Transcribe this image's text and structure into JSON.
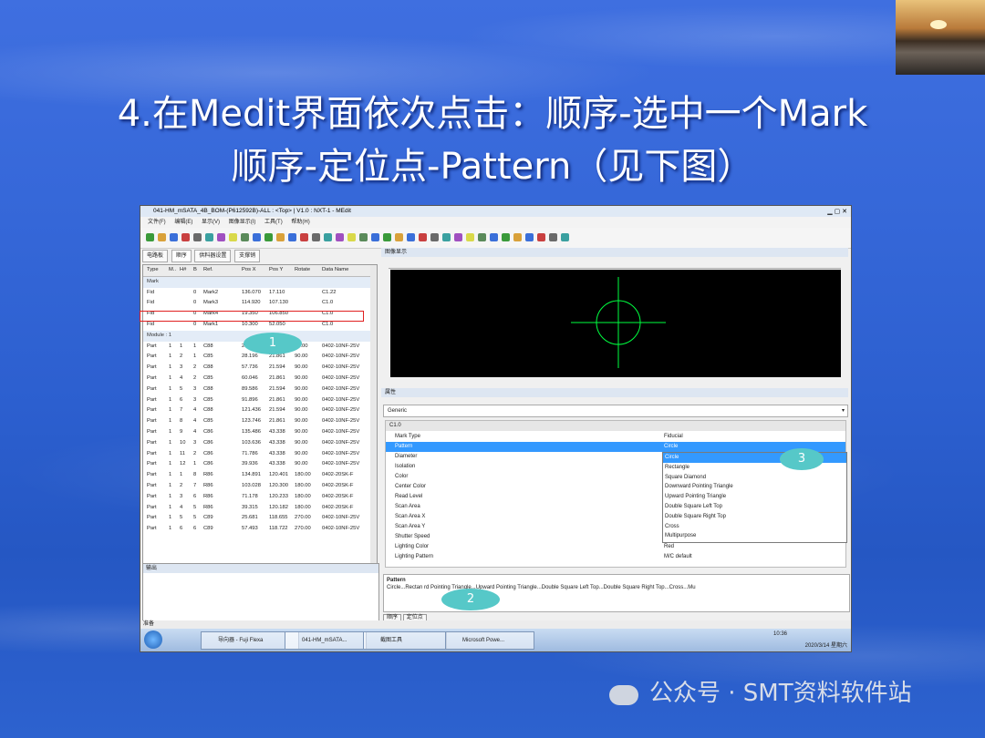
{
  "slide": {
    "title_line1": "4.在Medit界面依次点击：顺序-选中一个Mark",
    "title_line2": "顺序-定位点-Pattern（见下图）",
    "watermark": "公众号 · SMT资料软件站"
  },
  "window": {
    "title": "041-HM_mSATA_4B_BOM-(P612592B)-ALL : <Top> | V1.0 : NXT-1 - MEdit",
    "menu": [
      "文件(F)",
      "编辑(E)",
      "显示(V)",
      "图像显示(I)",
      "工具(T)",
      "帮助(H)"
    ],
    "tabs": [
      "电路板",
      "顺序",
      "供料器设置",
      "支撑销"
    ],
    "grid_headers": [
      "Type",
      "M..",
      "H#",
      "B",
      "Ref.",
      "Pos X",
      "Pos Y",
      "Rotate",
      "Data Name"
    ],
    "mark_group": "Mark",
    "mark_rows": [
      [
        "Fid",
        "",
        "",
        "0",
        "Mark2",
        "136.070",
        "17.110",
        "",
        "C1.22"
      ],
      [
        "Fid",
        "",
        "",
        "0",
        "Mark3",
        "114.920",
        "107.130",
        "",
        "C1.0"
      ],
      [
        "Fid",
        "",
        "",
        "0",
        "Mark4",
        "19.350",
        "106.850",
        "",
        "C1.0"
      ],
      [
        "Fid",
        "",
        "",
        "0",
        "Mark1",
        "10.300",
        "52.050",
        "",
        "C1.0"
      ]
    ],
    "module_group": "Module : 1",
    "part_rows": [
      [
        "Part",
        "1",
        "1",
        "1",
        "C88",
        "25.800",
        "21.594",
        "90.00",
        "0402-10NF-25V"
      ],
      [
        "Part",
        "1",
        "2",
        "1",
        "C85",
        "28.196",
        "21.861",
        "90.00",
        "0402-10NF-25V"
      ],
      [
        "Part",
        "1",
        "3",
        "2",
        "C88",
        "57.736",
        "21.594",
        "90.00",
        "0402-10NF-25V"
      ],
      [
        "Part",
        "1",
        "4",
        "2",
        "C85",
        "60.046",
        "21.861",
        "90.00",
        "0402-10NF-25V"
      ],
      [
        "Part",
        "1",
        "5",
        "3",
        "C88",
        "89.586",
        "21.594",
        "90.00",
        "0402-10NF-25V"
      ],
      [
        "Part",
        "1",
        "6",
        "3",
        "C85",
        "91.896",
        "21.861",
        "90.00",
        "0402-10NF-25V"
      ],
      [
        "Part",
        "1",
        "7",
        "4",
        "C88",
        "121.436",
        "21.594",
        "90.00",
        "0402-10NF-25V"
      ],
      [
        "Part",
        "1",
        "8",
        "4",
        "C85",
        "123.746",
        "21.861",
        "90.00",
        "0402-10NF-25V"
      ],
      [
        "Part",
        "1",
        "9",
        "4",
        "C86",
        "135.486",
        "43.338",
        "90.00",
        "0402-10NF-25V"
      ],
      [
        "Part",
        "1",
        "10",
        "3",
        "C86",
        "103.636",
        "43.338",
        "90.00",
        "0402-10NF-25V"
      ],
      [
        "Part",
        "1",
        "11",
        "2",
        "C86",
        "71.786",
        "43.338",
        "90.00",
        "0402-10NF-25V"
      ],
      [
        "Part",
        "1",
        "12",
        "1",
        "C86",
        "39.936",
        "43.338",
        "90.00",
        "0402-10NF-25V"
      ],
      [
        "Part",
        "1",
        "1",
        "8",
        "R86",
        "134.891",
        "120.401",
        "180.00",
        "0402-20SK-F"
      ],
      [
        "Part",
        "1",
        "2",
        "7",
        "R86",
        "103.028",
        "120.300",
        "180.00",
        "0402-20SK-F"
      ],
      [
        "Part",
        "1",
        "3",
        "6",
        "R86",
        "71.178",
        "120.233",
        "180.00",
        "0402-20SK-F"
      ],
      [
        "Part",
        "1",
        "4",
        "5",
        "R86",
        "39.315",
        "120.182",
        "180.00",
        "0402-20SK-F"
      ],
      [
        "Part",
        "1",
        "5",
        "5",
        "C89",
        "25.681",
        "118.655",
        "270.00",
        "0402-10NF-25V"
      ],
      [
        "Part",
        "1",
        "6",
        "6",
        "C89",
        "57.493",
        "118.722",
        "270.00",
        "0402-10NF-25V"
      ]
    ],
    "image_panel_title": "图像显示",
    "props_panel_title": "属性",
    "generic_label": "Generic",
    "section_label": "C1.0",
    "props": [
      [
        "Mark Type",
        "Fiducial"
      ],
      [
        "Pattern",
        "Circle"
      ],
      [
        "Diameter",
        ""
      ],
      [
        "Isolation",
        ""
      ],
      [
        "Color",
        ""
      ],
      [
        "Center Color",
        ""
      ],
      [
        "Read Level",
        ""
      ],
      [
        "Scan Area",
        ""
      ],
      [
        "Scan Area X",
        ""
      ],
      [
        "Scan Area Y",
        ""
      ],
      [
        "Shutter Speed",
        ""
      ],
      [
        "Lighting Color",
        "Red"
      ],
      [
        "Lighting Pattern",
        "M/C default"
      ]
    ],
    "dropdown_options": [
      "Circle",
      "Rectangle",
      "Square Diamond",
      "Downward Pointing Triangle",
      "Upward Pointing Triangle",
      "Double Square Left Top",
      "Double Square Right Top",
      "Cross",
      "Multipurpose"
    ],
    "desc_title": "Pattern",
    "desc_text": "Circle...Rectan                          rd Pointing Triangle...Upward Pointing Triangle...Double Square Left Top...Double Square Right Top...Cross...Mu",
    "output_title": "输出",
    "bottom_tabs": [
      "顺序",
      "定位点"
    ],
    "status": "准备",
    "taskbar": [
      "导向器 - Fuji Flexa",
      "041-HM_mSATA...",
      "截图工具",
      "Microsoft Powe..."
    ],
    "clock": "10:36",
    "date": "2020/3/14 星期六"
  },
  "callouts": [
    "1",
    "2",
    "3"
  ],
  "colors": {
    "accent_blue": "#3567d8",
    "callout": "#56c8c8",
    "highlight_red": "#e02020",
    "crosshair": "#00ff40"
  }
}
